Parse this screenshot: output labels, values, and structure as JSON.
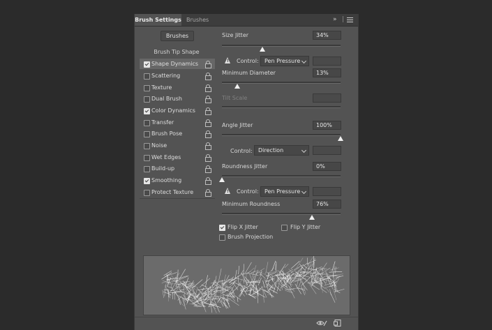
{
  "tabs": {
    "active": "Brush Settings",
    "inactive": "Brushes",
    "expand_glyph": "»",
    "menu_icon": "hamburger-menu-icon"
  },
  "sidebar": {
    "brushes_button": "Brushes",
    "tip_shape_header": "Brush Tip Shape",
    "items": [
      {
        "label": "Shape Dynamics",
        "checked": true,
        "selected": true
      },
      {
        "label": "Scattering",
        "checked": false,
        "selected": false
      },
      {
        "label": "Texture",
        "checked": false,
        "selected": false
      },
      {
        "label": "Dual Brush",
        "checked": false,
        "selected": false
      },
      {
        "label": "Color Dynamics",
        "checked": true,
        "selected": false
      },
      {
        "label": "Transfer",
        "checked": false,
        "selected": false
      },
      {
        "label": "Brush Pose",
        "checked": false,
        "selected": false
      },
      {
        "label": "Noise",
        "checked": false,
        "selected": false
      },
      {
        "label": "Wet Edges",
        "checked": false,
        "selected": false
      },
      {
        "label": "Build-up",
        "checked": false,
        "selected": false
      },
      {
        "label": "Smoothing",
        "checked": true,
        "selected": false
      },
      {
        "label": "Protect Texture",
        "checked": false,
        "selected": false
      }
    ]
  },
  "settings": {
    "size_jitter": {
      "label": "Size Jitter",
      "value": "34%",
      "level": 0.34
    },
    "control1": {
      "label": "Control:",
      "value": "Pen Pressure"
    },
    "min_diameter": {
      "label": "Minimum Diameter",
      "value": "13%",
      "level": 0.13
    },
    "tilt_scale": {
      "label": "Tilt Scale"
    },
    "angle_jitter": {
      "label": "Angle Jitter",
      "value": "100%",
      "level": 1.0
    },
    "control2": {
      "label": "Control:",
      "value": "Direction"
    },
    "roundness_jitter": {
      "label": "Roundness Jitter",
      "value": "0%",
      "level": 0.0
    },
    "control3": {
      "label": "Control:",
      "value": "Pen Pressure"
    },
    "min_roundness": {
      "label": "Minimum Roundness",
      "value": "76%",
      "level": 0.76
    },
    "flip_x": {
      "label": "Flip X Jitter",
      "checked": true
    },
    "flip_y": {
      "label": "Flip Y Jitter",
      "checked": false
    },
    "brush_projection": {
      "label": "Brush Projection",
      "checked": false
    }
  },
  "footer": {
    "icons": [
      "eye-brush-icon",
      "new-preset-icon"
    ]
  },
  "colors": {
    "panel": "#535353",
    "tabbar": "#3d3d3d",
    "background": "#2b2b2b",
    "preview": "#6b6b6b"
  }
}
